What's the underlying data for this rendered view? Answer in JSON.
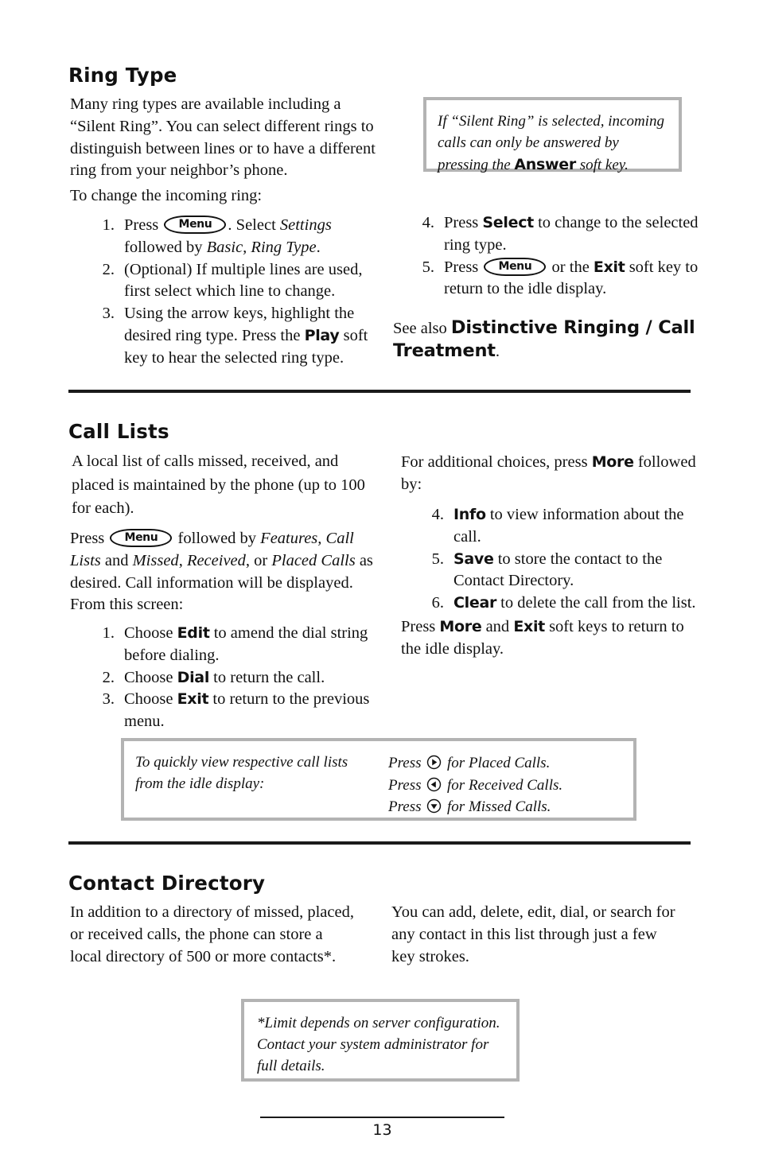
{
  "page": {
    "number": "13"
  },
  "sections": {
    "ring_type": {
      "heading": "Ring Type",
      "intro": "Many ring types are available including a “Silent Ring”.  You can select different rings to distinguish between lines or to have a different ring from your neighbor’s phone.",
      "lead_in": "To change the incoming ring:",
      "steps": [
        {
          "num": "1.",
          "before": "Press",
          "key": "Menu",
          "after_1": ".  Select ",
          "italic_1": "Settings",
          "after_2": " followed by ",
          "italic_2": "Basic, Ring Type",
          "after_3": "."
        },
        {
          "num": "2.",
          "text": "(Optional)  If multiple lines are used, first select which line to change."
        },
        {
          "num": "3.",
          "before": "Using the arrow keys, highlight the desired ring type.  Press the ",
          "bold": "Play",
          "after": " soft key to hear the selected ring type."
        },
        {
          "num": "4.",
          "before": "Press ",
          "bold": "Select",
          "after": " to change to the selected ring type."
        },
        {
          "num": "5.",
          "before": "Press",
          "key": "Menu",
          "mid": " or the ",
          "bold": "Exit",
          "after": " soft key to return to the idle display."
        }
      ],
      "note": {
        "before": "If “Silent Ring” is selected, incoming calls can only be answered by pressing the ",
        "bold": "Answer",
        "after": " soft key."
      },
      "see_also": {
        "prefix": "See also ",
        "bold": "Distinctive Ringing / Call Treatment",
        "suffix": "."
      }
    },
    "call_lists": {
      "heading": "Call Lists",
      "para_1": "A local list of calls missed, received, and placed is maintained by the phone (up to 100 for each).",
      "para_2": {
        "before": "Press",
        "key": "Menu",
        "after_1": " followed by ",
        "italic_1": "Features, Call Lists",
        "after_2": " and ",
        "italic_2": "Missed",
        "after_3": ", ",
        "italic_3": "Received",
        "after_4": ", or ",
        "italic_4": "Placed Calls",
        "after_5": " as desired.  Call information will be displayed.  From this screen:"
      },
      "steps_left": [
        {
          "num": "1.",
          "before": "Choose ",
          "bold": "Edit",
          "after": " to amend the dial string before dialing."
        },
        {
          "num": "2.",
          "before": "Choose ",
          "bold": "Dial",
          "after": " to return the call."
        },
        {
          "num": "3.",
          "before": "Choose ",
          "bold": "Exit",
          "after": " to return to the previous menu."
        }
      ],
      "right_intro": {
        "before": "For additional choices, press ",
        "bold": "More",
        "after": " followed by:"
      },
      "steps_right": [
        {
          "num": "4.",
          "bold": "Info",
          "after": " to view information about the call."
        },
        {
          "num": "5.",
          "bold": "Save",
          "after": " to store the contact to the Contact Directory."
        },
        {
          "num": "6.",
          "bold": "Clear",
          "after": " to delete the call from the list."
        }
      ],
      "right_outro": {
        "p_1": "Press ",
        "bold_1": "More",
        "p_2": " and ",
        "bold_2": "Exit",
        "p_3": " soft keys to return to the idle display."
      },
      "note": {
        "left": "To quickly view respective call lists from the idle display:",
        "rows": [
          {
            "before": "Press ",
            "icon": "arrow-right-icon",
            "after": " for Placed Calls."
          },
          {
            "before": "Press ",
            "icon": "arrow-left-icon",
            "after": " for Received Calls."
          },
          {
            "before": "Press ",
            "icon": "arrow-down-icon",
            "after": " for Missed Calls."
          }
        ]
      }
    },
    "contact_directory": {
      "heading": "Contact Directory",
      "para_left": "In addition to a directory of missed, placed, or received calls, the phone can store a local directory of 500 or more contacts*.",
      "para_right": "You can add, delete, edit, dial, or search for any contact in this list through just a few key strokes.",
      "note": "*Limit depends on server configuration. Contact your system administrator for full details."
    }
  },
  "colors": {
    "text": "#111111",
    "note_border": "#b3b3b3",
    "rule": "#1a1a1a"
  }
}
